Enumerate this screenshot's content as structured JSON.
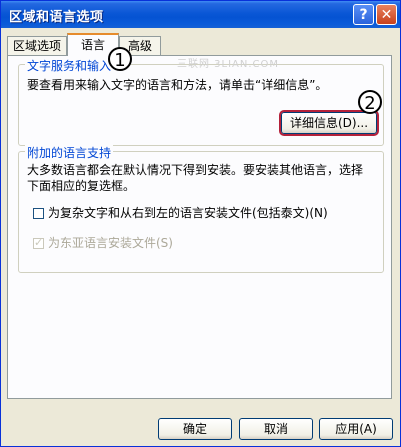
{
  "window": {
    "title": "区域和语言选项",
    "help_label": "?",
    "close_label": "✕"
  },
  "tabs": [
    {
      "label": "区域选项",
      "selected": false
    },
    {
      "label": "语言",
      "selected": true
    },
    {
      "label": "高级",
      "selected": false
    }
  ],
  "text_services": {
    "legend": "文字服务和输入",
    "description": "要查看用来输入文字的语言和方法，请单击“详细信息”。",
    "details_button": "详细信息(D)..."
  },
  "supplemental": {
    "legend": "附加的语言支持",
    "description_line1": "大多数语言都会在默认情况下得到安装。要安装其他语言，选择",
    "description_line2": "下面相应的复选框。",
    "complex_script_label": "为复杂文字和从右到左的语言安装文件(包括泰文)(N)",
    "complex_script_checked": false,
    "east_asian_label": "为东亚语言安装文件(S)",
    "east_asian_checked": true,
    "east_asian_enabled": false
  },
  "callouts": {
    "one": "1",
    "two": "2"
  },
  "watermark": "三联网 3LIAN.COM",
  "footer": {
    "ok": "确定",
    "cancel": "取消",
    "apply": "应用(A)"
  }
}
